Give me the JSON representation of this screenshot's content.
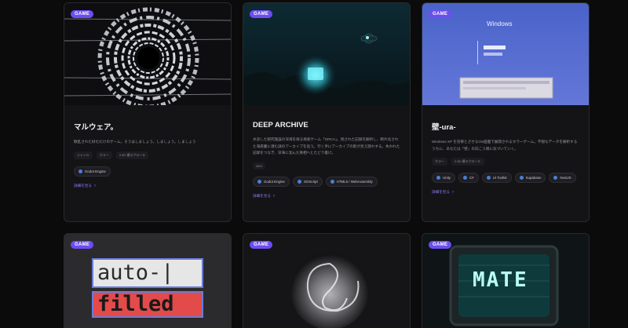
{
  "cards": [
    {
      "badge": "GAME",
      "title": "マルウェア。",
      "desc": "散乱された好むだけのゲーム。そうはしましょう。しましょう。しましょう",
      "tags": [
        "ジャンル",
        "ホラー",
        "2.5D 横スクロール"
      ],
      "tech": [
        "Godot Engine"
      ],
      "more": "詳細を見る",
      "thumb_icon": "vortex-art-icon"
    },
    {
      "badge": "GAME",
      "title": "DEEP ARCHIVE",
      "desc": "水没した研究施設の深海を探る探索ゲーム「ORCA」。残された記録を解析し、断片化された海底層に潜む謎のアーカイブを追う。行く手にアーカイブの影が見え隠れする。失われた記録をつなぎ、深海に沈んだ真相へとたどり着け。",
      "tags": [
        "ADV"
      ],
      "tech": [
        "Godot Engine",
        "GDScript",
        "HTML5 / WebAssembly"
      ],
      "more": "詳細を見る",
      "thumb_icon": "deep-sea-art-icon"
    },
    {
      "badge": "GAME",
      "title": "壁-ura-",
      "desc": "Windows XP を彷彿とさせるOS画面で展開されるホラーゲーム。不穏なデータを解析するうちに、あなたは「壁」の向こう側に気づいていく。",
      "tags": [
        "ホラー",
        "2.5D 横スクロール"
      ],
      "tech": [
        "Unity",
        "C#",
        "UI Toolkit",
        "Supabase",
        "NextJS"
      ],
      "more": "詳細を見る",
      "thumb_icon": "os-screen-art-icon",
      "screen_title": "Windows"
    },
    {
      "badge": "GAME",
      "thumb_icon": "autofilled-art-icon",
      "art_line1": "auto-|",
      "art_line2": "filled"
    },
    {
      "badge": "GAME",
      "thumb_icon": "swirl-art-icon"
    },
    {
      "badge": "GAME",
      "thumb_icon": "crt-monitor-art-icon",
      "art_text": "MATE"
    }
  ],
  "colors": {
    "accent": "#6d4df2",
    "link": "#8a7cff",
    "card_bg": "#141416",
    "page_bg": "#0b0b0c"
  }
}
